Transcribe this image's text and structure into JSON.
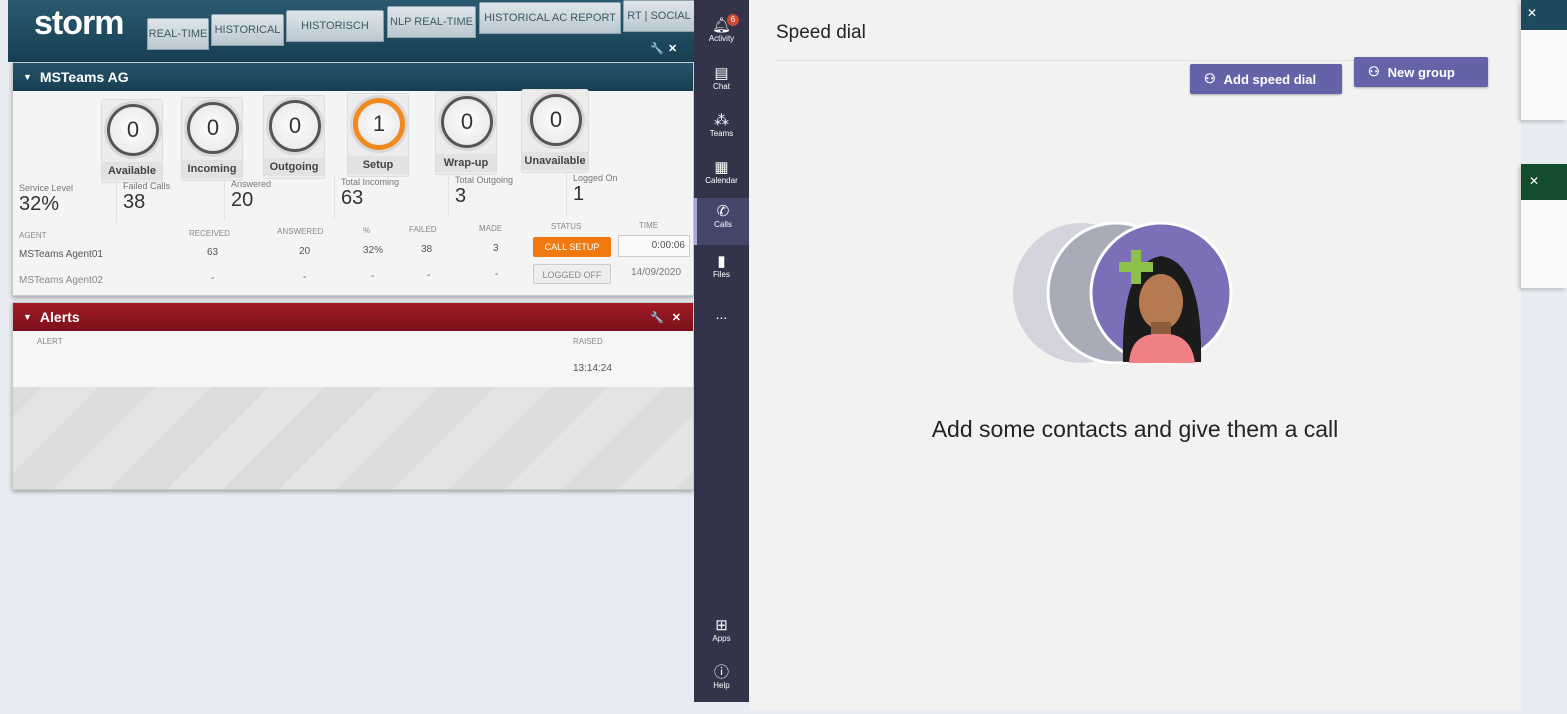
{
  "storm": {
    "logo": "storm",
    "tabs": [
      "REAL-TIME",
      "HISTORICAL",
      "HISTORISCH",
      "NLP REAL-TIME",
      "HISTORICAL AC REPORT",
      "RT | SOCIAL"
    ],
    "panel": {
      "title": "MSTeams AG",
      "gauges": [
        {
          "value": "0",
          "label": "Available"
        },
        {
          "value": "0",
          "label": "Incoming"
        },
        {
          "value": "0",
          "label": "Outgoing"
        },
        {
          "value": "1",
          "label": "Setup"
        },
        {
          "value": "0",
          "label": "Wrap-up"
        },
        {
          "value": "0",
          "label": "Unavailable"
        }
      ],
      "stats": [
        {
          "label": "Service Level",
          "value": "32%"
        },
        {
          "label": "Failed Calls",
          "value": "38"
        },
        {
          "label": "Answered",
          "value": "20"
        },
        {
          "label": "Total Incoming",
          "value": "63"
        },
        {
          "label": "Total Outgoing",
          "value": "3"
        },
        {
          "label": "Logged On",
          "value": "1"
        }
      ],
      "columns": [
        "Agent",
        "Received",
        "Answered",
        "%",
        "Failed",
        "Made",
        "Status",
        "Time"
      ],
      "rows": [
        {
          "agent": "MSTeams Agent01",
          "received": "63",
          "answered": "20",
          "pct": "32%",
          "failed": "38",
          "made": "3",
          "status": "CALL SETUP",
          "time": "0:00:06"
        },
        {
          "agent": "MSTeams Agent02",
          "received": "-",
          "answered": "-",
          "pct": "-",
          "failed": "-",
          "made": "-",
          "status": "LOGGED OFF",
          "time": "14/09/2020"
        }
      ]
    },
    "alerts": {
      "title": "Alerts",
      "columns": [
        "Alert",
        "Raised"
      ],
      "rows": [
        {
          "alert": "",
          "raised": "13:14:24"
        }
      ]
    },
    "colors": {
      "header": "#1d4a5e",
      "alerts": "#8e1520",
      "setup": "#f08a1e"
    }
  },
  "teams": {
    "rail": [
      {
        "label": "Activity",
        "icon": "bell-icon",
        "badge": "6"
      },
      {
        "label": "Chat",
        "icon": "chat-icon"
      },
      {
        "label": "Teams",
        "icon": "teams-icon"
      },
      {
        "label": "Calendar",
        "icon": "calendar-icon"
      },
      {
        "label": "Calls",
        "icon": "phone-icon",
        "active": true
      },
      {
        "label": "Files",
        "icon": "file-icon"
      },
      {
        "label": "...",
        "icon": "more-icon"
      },
      {
        "label": "Apps",
        "icon": "apps-icon"
      },
      {
        "label": "Help",
        "icon": "help-icon"
      }
    ],
    "title": "Speed dial",
    "add_speed_dial": "Add speed dial",
    "new_group": "New group",
    "empty_message": "Add some contacts and give them a call",
    "accent": "#6264a7"
  }
}
